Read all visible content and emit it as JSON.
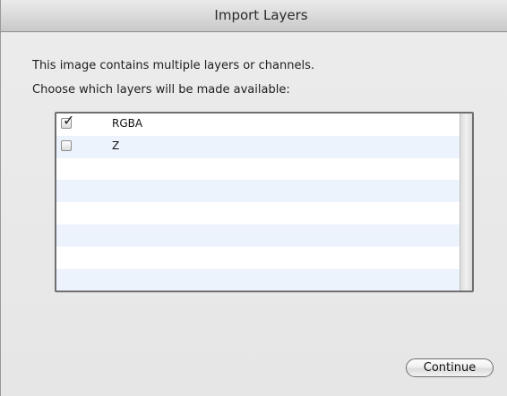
{
  "window": {
    "title": "Import Layers"
  },
  "message": {
    "line1": "This image contains multiple layers or channels.",
    "line2": "Choose which layers will be made available:"
  },
  "layers": [
    {
      "name": "RGBA",
      "checked": true,
      "checkmark": "✓"
    },
    {
      "name": "Z",
      "checked": false
    }
  ],
  "continue_label": "Continue"
}
